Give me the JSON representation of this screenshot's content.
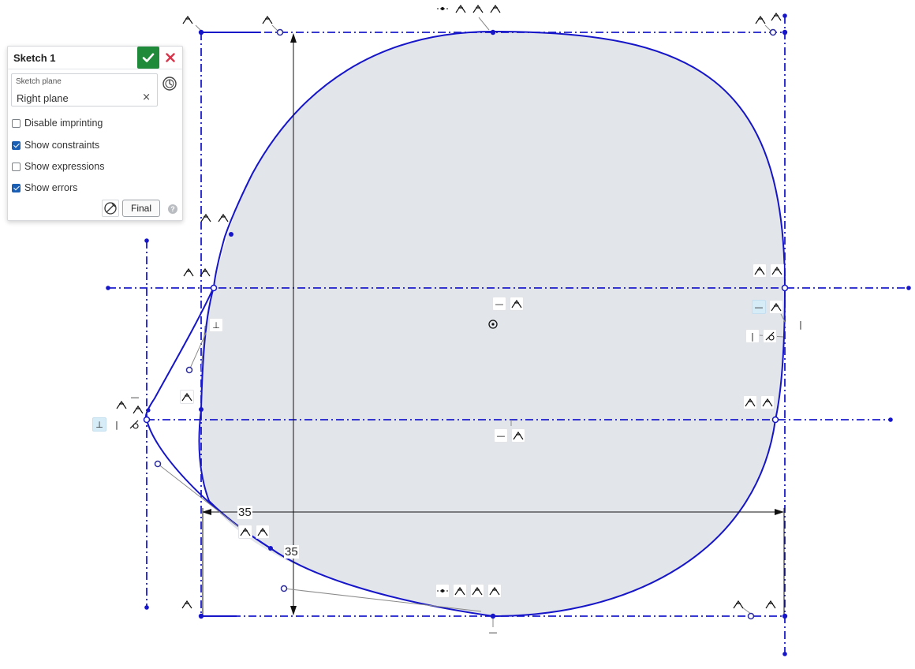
{
  "panel": {
    "title": "Sketch 1",
    "sketch_plane_caption": "Sketch plane",
    "sketch_plane_value": "Right plane",
    "clear_symbol": "×",
    "options": [
      {
        "label": "Disable imprinting",
        "checked": false
      },
      {
        "label": "Show constraints",
        "checked": true
      },
      {
        "label": "Show expressions",
        "checked": false
      },
      {
        "label": "Show errors",
        "checked": true
      }
    ],
    "final_label": "Final",
    "help_symbol": "?",
    "colors": {
      "accept": "#1f8a3a",
      "cancel": "#d9344a",
      "checkbox": "#1a5fb4"
    }
  },
  "dimensions": {
    "horizontal": "35",
    "vertical": "35"
  },
  "sketch": {
    "curve_color": "#1616c8",
    "fill_color": "#e2e5ea",
    "dimension_color": "#222222"
  },
  "constraint_glyphs": {
    "horizontal": "—",
    "vertical": "|",
    "perpendicular": "⊥"
  },
  "icons": [
    "check-icon",
    "close-icon",
    "history-icon",
    "sketch-tool-icon",
    "help-icon",
    "centroid-icon"
  ]
}
